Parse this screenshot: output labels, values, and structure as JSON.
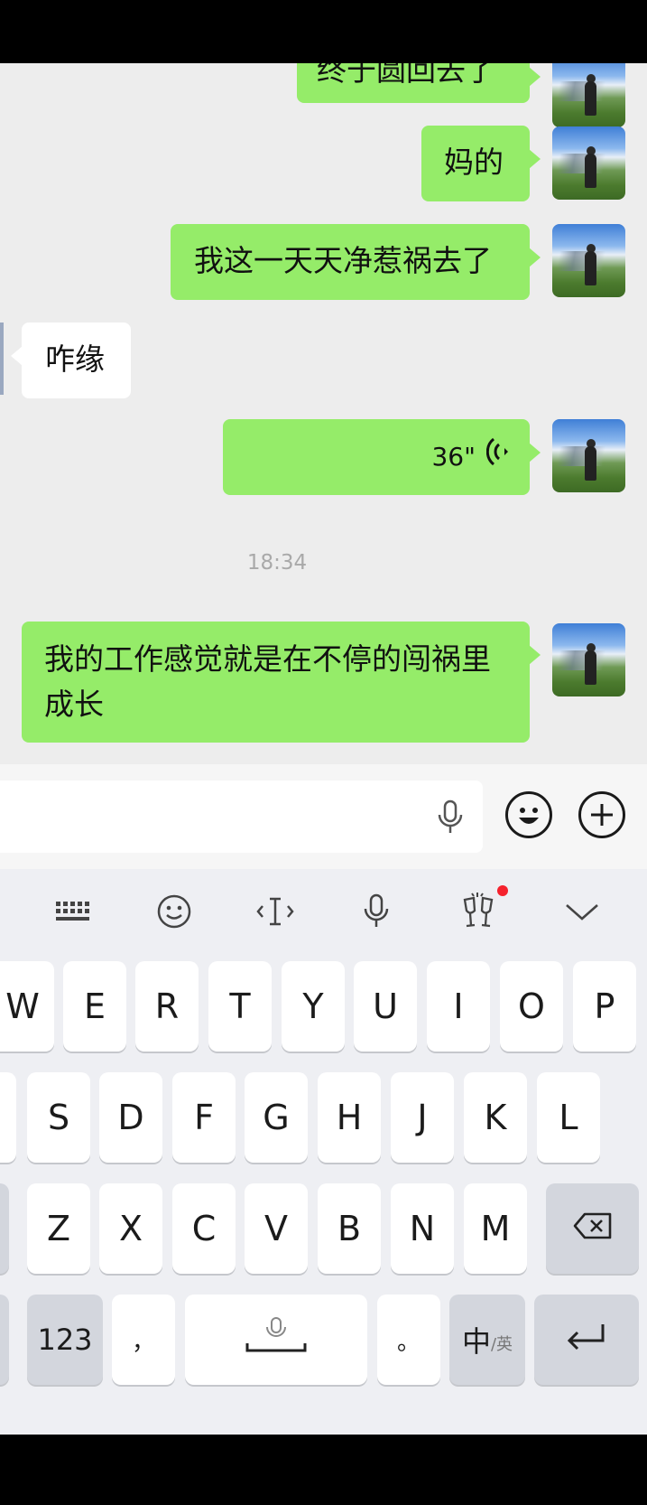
{
  "messages": [
    {
      "side": "me",
      "text": "终于圆回去了"
    },
    {
      "side": "me",
      "text": "妈的"
    },
    {
      "side": "me",
      "text": "我这一天天净惹祸去了"
    },
    {
      "side": "them",
      "text": "咋缘"
    },
    {
      "side": "me",
      "type": "voice",
      "duration": "36\""
    },
    {
      "side": "me",
      "text_line1": "我的工作感觉就是在不停的闯祸里",
      "text_line2": "成长"
    }
  ],
  "timestamp": "18:34",
  "input": {
    "placeholder": ""
  },
  "keyboard": {
    "row1": [
      "W",
      "E",
      "R",
      "T",
      "Y",
      "U",
      "I",
      "O",
      "P"
    ],
    "row2": [
      "S",
      "D",
      "F",
      "G",
      "H",
      "J",
      "K",
      "L"
    ],
    "row3": [
      "Z",
      "X",
      "C",
      "V",
      "B",
      "N",
      "M"
    ],
    "numbers_key": "123",
    "comma_key": "，",
    "period_key": "。",
    "lang_key_main": "中",
    "lang_key_sub": "/英"
  },
  "icons": [
    "voice-input-icon",
    "emoji-icon",
    "plus-icon",
    "keyboard-grid-icon",
    "keyboard-emoji-icon",
    "cursor-icon",
    "keyboard-mic-icon",
    "cheers-icon",
    "collapse-chevron-icon",
    "backspace-icon",
    "enter-icon"
  ],
  "colors": {
    "my_bubble": "#95ec69",
    "their_bubble": "#ffffff",
    "chat_bg": "#ededed",
    "notification_dot": "#f5222d"
  }
}
